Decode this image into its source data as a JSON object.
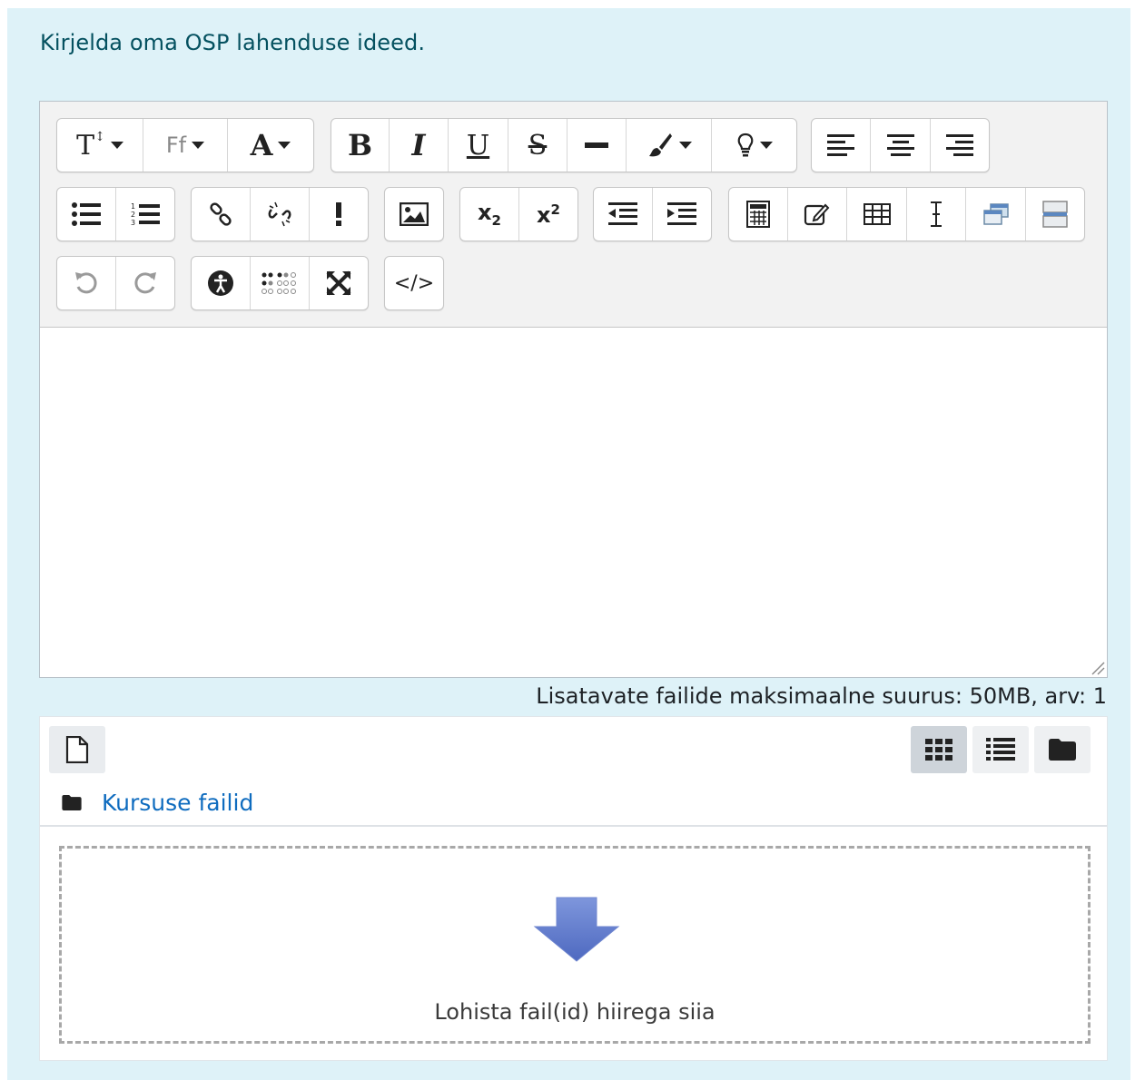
{
  "question": {
    "text": "Kirjelda oma OSP lahenduse ideed."
  },
  "editor": {
    "toolbar_glyphs": {
      "font_family": "Ff",
      "font_color": "A",
      "bold": "B",
      "italic": "I",
      "underline": "U",
      "strike": "S",
      "subscript_base": "x",
      "subscript_index": "2",
      "superscript_base": "x",
      "superscript_index": "2",
      "html": "</>"
    },
    "icons": [
      "font-size-icon",
      "font-family-icon",
      "font-color-icon",
      "bold-icon",
      "italic-icon",
      "underline-icon",
      "strikethrough-icon",
      "horizontal-rule-icon",
      "brush-icon",
      "lightbulb-icon",
      "align-left-icon",
      "align-center-icon",
      "align-right-icon",
      "bullet-list-icon",
      "numbered-list-icon",
      "link-icon",
      "unlink-icon",
      "exclamation-icon",
      "image-icon",
      "subscript-icon",
      "superscript-icon",
      "outdent-icon",
      "indent-icon",
      "calculator-icon",
      "edit-icon",
      "table-icon",
      "cursor-icon",
      "windows-icon",
      "page-break-icon",
      "undo-icon",
      "redo-icon",
      "accessibility-icon",
      "braille-icon",
      "fullscreen-icon",
      "code-icon"
    ]
  },
  "files": {
    "limit_text": "Lisatavate failide maksimaalne suurus: 50MB, arv: 1",
    "path_link": "Kursuse failid",
    "drop_label": "Lohista fail(id) hiirega siia"
  },
  "colors": {
    "panel_bg": "#def2f8",
    "question_text": "#055160",
    "link": "#0f6cbf",
    "drop_arrow": "#5b79c8"
  }
}
